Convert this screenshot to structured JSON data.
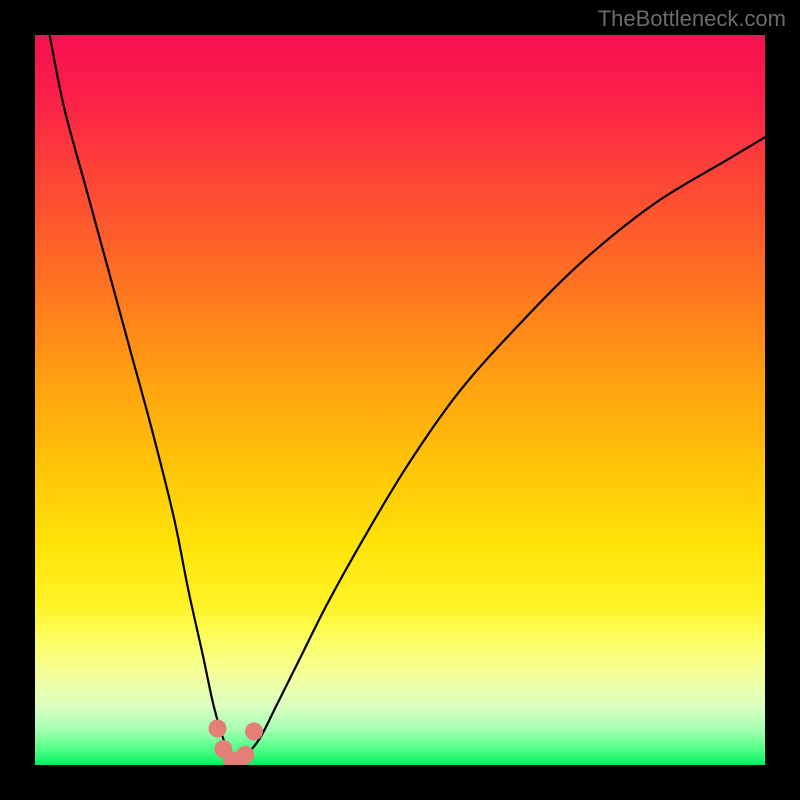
{
  "watermark": "TheBottleneck.com",
  "chart_data": {
    "type": "line",
    "title": "",
    "xlabel": "",
    "ylabel": "",
    "xlim": [
      0,
      100
    ],
    "ylim": [
      0,
      100
    ],
    "grid": false,
    "legend": false,
    "series": [
      {
        "name": "bottleneck-curve",
        "x": [
          2,
          4,
          7,
          10,
          13,
          16,
          19,
          21,
          23,
          24.5,
          26,
          27,
          28,
          29.5,
          31,
          33,
          36,
          40,
          45,
          51,
          58,
          66,
          75,
          85,
          95,
          100
        ],
        "values": [
          100,
          90,
          79,
          68,
          57,
          46,
          34,
          24,
          15,
          8,
          3,
          1,
          1,
          2,
          4,
          8,
          14,
          22,
          31,
          41,
          51,
          60,
          69,
          77,
          83,
          86
        ]
      }
    ],
    "markers": {
      "name": "highlight-cluster",
      "color": "#e37f77",
      "points": [
        {
          "x": 25.0,
          "y": 5.0
        },
        {
          "x": 25.8,
          "y": 2.2
        },
        {
          "x": 27.0,
          "y": 0.6
        },
        {
          "x": 27.8,
          "y": 0.6
        },
        {
          "x": 28.8,
          "y": 1.4
        },
        {
          "x": 30.0,
          "y": 4.6
        }
      ]
    },
    "background_gradient": {
      "direction": "vertical",
      "stops": [
        {
          "pos": 0.0,
          "color": "#f81050"
        },
        {
          "pos": 0.33,
          "color": "#ff6f22"
        },
        {
          "pos": 0.6,
          "color": "#ffc708"
        },
        {
          "pos": 0.83,
          "color": "#fcff63"
        },
        {
          "pos": 0.95,
          "color": "#a8ffb4"
        },
        {
          "pos": 1.0,
          "color": "#00f060"
        }
      ]
    }
  }
}
